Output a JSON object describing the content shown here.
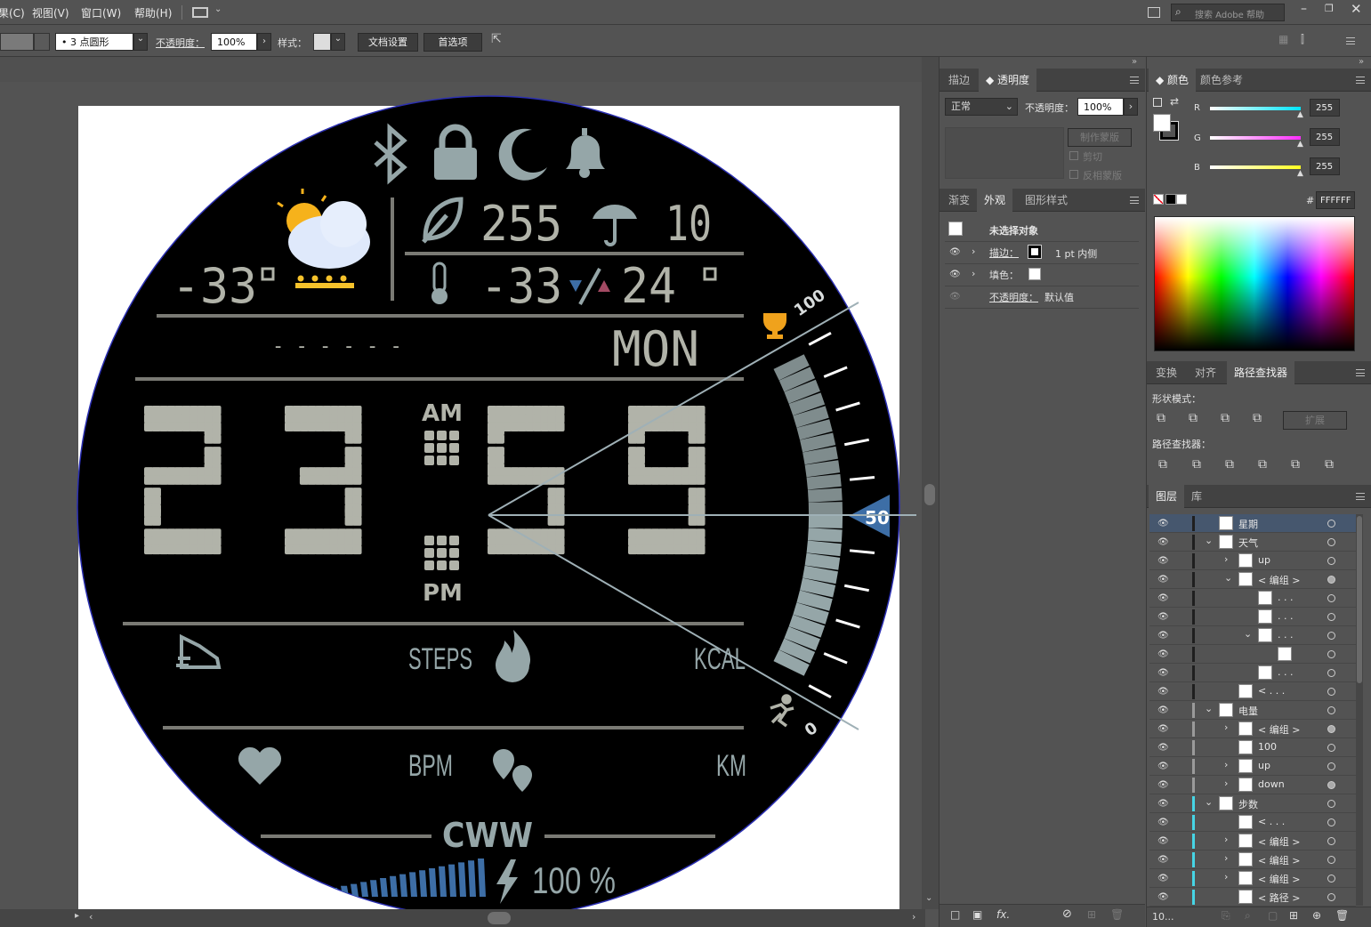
{
  "menu": {
    "items": [
      "果(C)",
      "视图(V)",
      "窗口(W)",
      "帮助(H)"
    ],
    "search_placeholder": "搜索 Adobe 帮助"
  },
  "control": {
    "brush": "3 点圆形",
    "opacity_label": "不透明度：",
    "opacity_value": "100%",
    "style_label": "样式：",
    "doc_setup": "文档设置",
    "prefs": "首选项"
  },
  "transparency_panel": {
    "tabs": [
      "描边",
      "透明度"
    ],
    "blend_mode": "正常",
    "opacity_label": "不透明度：",
    "opacity_value": "100%",
    "make_mask": "制作蒙版",
    "clip": "剪切",
    "invert": "反相蒙版"
  },
  "appearance_panel": {
    "tabs": [
      "渐变",
      "外观",
      "图形样式"
    ],
    "title": "未选择对象",
    "stroke_label": "描边：",
    "stroke_value": "1 pt  内侧",
    "fill_label": "填色：",
    "opacity_label": "不透明度：",
    "opacity_value": "默认值"
  },
  "color_panel": {
    "tabs": [
      "颜色",
      "颜色参考"
    ],
    "r_label": "R",
    "g_label": "G",
    "b_label": "B",
    "r": "255",
    "g": "255",
    "b": "255",
    "hash": "#",
    "hex": "FFFFFF",
    "r_color": "#00e5ff",
    "g_color": "#ff2dff",
    "b_color": "#ffff20"
  },
  "pathfinder_panel": {
    "tabs": [
      "变换",
      "对齐",
      "路径查找器"
    ],
    "shape_modes": "形状模式：",
    "expand": "扩展",
    "pathfinders": "路径查找器："
  },
  "layers_panel": {
    "tabs": [
      "图层",
      "库"
    ],
    "footer": "10...",
    "rows": [
      {
        "name": "星期",
        "indent": 0
      },
      {
        "name": "天气",
        "indent": 0
      },
      {
        "name": "up",
        "indent": 1
      },
      {
        "name": "< 编组 >",
        "indent": 1
      },
      {
        "name": ". . .",
        "indent": 2
      },
      {
        "name": ". . .",
        "indent": 2
      },
      {
        "name": ". . .",
        "indent": 2
      },
      {
        "name": "",
        "indent": 3
      },
      {
        "name": ". . .",
        "indent": 2
      },
      {
        "name": "< . . .",
        "indent": 1
      },
      {
        "name": "电量",
        "indent": 0
      },
      {
        "name": "< 编组 >",
        "indent": 1
      },
      {
        "name": "100",
        "indent": 1
      },
      {
        "name": "up",
        "indent": 1
      },
      {
        "name": "down",
        "indent": 1
      },
      {
        "name": "步数",
        "indent": 0
      },
      {
        "name": "< . . .",
        "indent": 1
      },
      {
        "name": "< 编组 >",
        "indent": 1
      },
      {
        "name": "< 编组 >",
        "indent": 1
      },
      {
        "name": "< 编组 >",
        "indent": 1
      },
      {
        "name": "< 路径 >",
        "indent": 1
      }
    ]
  },
  "watch": {
    "temp_left": "-33",
    "humidity": "255",
    "uv": "10",
    "temp_low": "-33",
    "temp_high": "24",
    "date": "- - -   - - -",
    "weekday": "MON",
    "hours": "23",
    "minutes": "59",
    "am": "AM",
    "pm": "PM",
    "steps_label": "STEPS",
    "kcal_label": "KCAL",
    "bpm_label": "BPM",
    "km_label": "KM",
    "gauge_max": "100",
    "gauge_value": "50",
    "gauge_min": "0",
    "battery": "100 %",
    "logo": "CWW",
    "gauge_level": 0.5,
    "battery_level": 1.0,
    "accent_blue": "#3d6ea6",
    "ink_gray": "#95a6a8"
  }
}
